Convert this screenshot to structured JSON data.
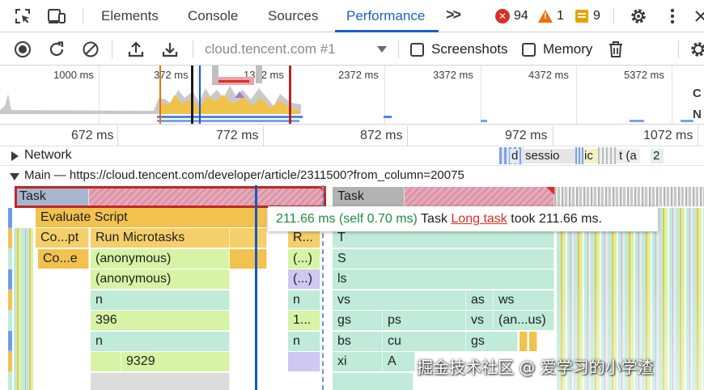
{
  "tabs": {
    "items": [
      {
        "label": "Elements"
      },
      {
        "label": "Console"
      },
      {
        "label": "Sources"
      },
      {
        "label": "Performance",
        "active": true
      }
    ],
    "more_icon": "chevron-double-right-icon"
  },
  "status": {
    "errors": "94",
    "warnings": "1",
    "issues": "9",
    "error_color": "#d93025",
    "warning_color": "#e8710a",
    "issue_color": "#e8a300"
  },
  "toolbar": {
    "session": "cloud.tencent.com #1",
    "screenshots_label": "Screenshots",
    "memory_label": "Memory"
  },
  "overview": {
    "ticks": [
      "1000 ms",
      "372 ms",
      "1372 ms",
      "2372 ms",
      "3372 ms",
      "4372 ms",
      "5372 ms"
    ]
  },
  "ruler": {
    "ticks": [
      "672 ms",
      "772 ms",
      "872 ms",
      "972 ms",
      "1072 ms"
    ]
  },
  "tracks": {
    "network_label": "Network",
    "network_items": [
      "d",
      "sessio",
      "ic",
      "t (a",
      "2"
    ],
    "main_label": "Main — https://cloud.tencent.com/developer/article/2311500?from_column=20075"
  },
  "flame": {
    "task1": "Task",
    "task2": "Task",
    "evaluate": "Evaluate Script",
    "compile": "Co...pt",
    "microtasks": "Run Microtasks",
    "r_short": "R...",
    "compile2": "Co...e",
    "anon1": "(anonymous)",
    "anon2": "(anonymous)",
    "anon_short1": "(...)",
    "anon_short2": "(...)",
    "n1": "n",
    "n2": "n",
    "n3": "n",
    "n4": "n",
    "v396": "396",
    "v1": "1...",
    "v9329": "9329",
    "T": "T",
    "S": "S",
    "ls": "ls",
    "vs": "vs",
    "gs": "gs",
    "bs": "bs",
    "xi": "xi",
    "ps": "ps",
    "cu": "cu",
    "A": "A",
    "as": "as",
    "vs2": "vs",
    "gs2": "gs",
    "ws": "ws",
    "anus": "(an...us)"
  },
  "tooltip": {
    "time": "211.66 ms (self 0.70 ms)",
    "name": "Task",
    "link": "Long task",
    "suffix": "took 211.66 ms."
  },
  "watermark": "掘金技术社区 @ 爱学习的小学渣"
}
